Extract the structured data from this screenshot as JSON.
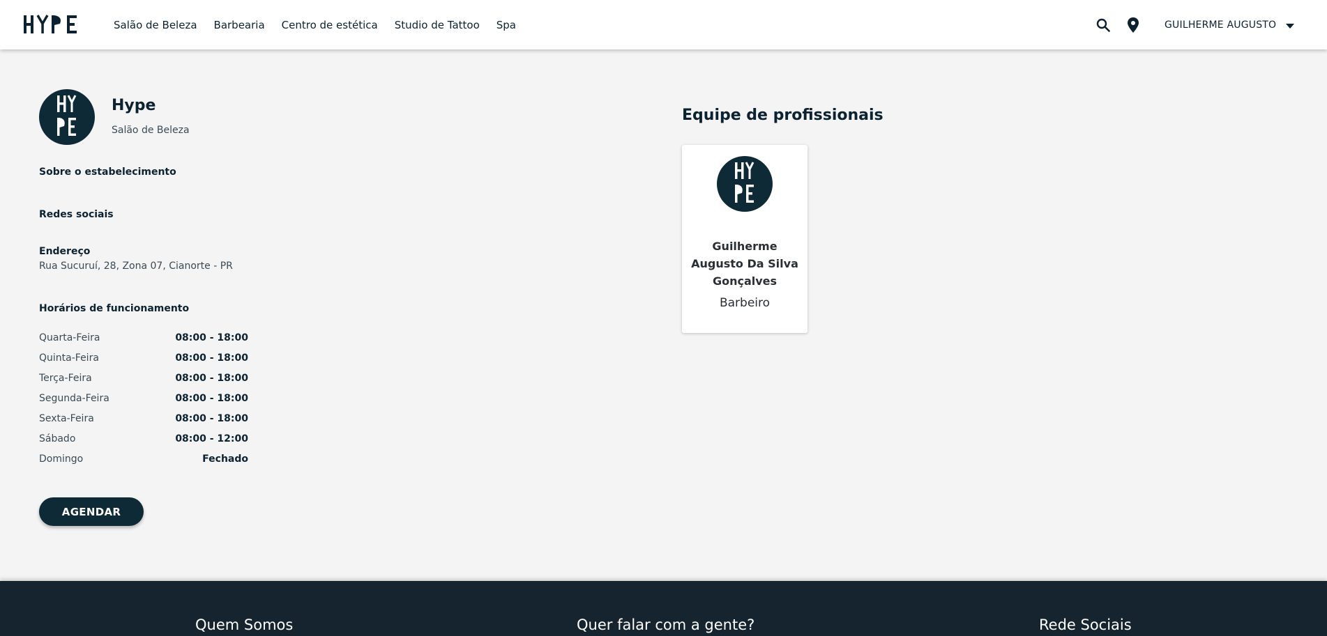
{
  "header": {
    "nav": [
      "Salão de Beleza",
      "Barbearia",
      "Centro de estética",
      "Studio de Tattoo",
      "Spa"
    ],
    "user_name": "GUILHERME AUGUSTO"
  },
  "establishment": {
    "name": "Hype",
    "category": "Salão de Beleza",
    "about_title": "Sobre o estabelecimento",
    "social_title": "Redes sociais",
    "address_title": "Endereço",
    "address": "Rua Sucuruí, 28, Zona 07, Cianorte - PR",
    "hours_title": "Horários de funcionamento",
    "hours": [
      {
        "day": "Quarta-Feira",
        "time": "08:00 - 18:00"
      },
      {
        "day": "Quinta-Feira",
        "time": "08:00 - 18:00"
      },
      {
        "day": "Terça-Feira",
        "time": "08:00 - 18:00"
      },
      {
        "day": "Segunda-Feira",
        "time": "08:00 - 18:00"
      },
      {
        "day": "Sexta-Feira",
        "time": "08:00 - 18:00"
      },
      {
        "day": "Sábado",
        "time": "08:00 - 12:00"
      },
      {
        "day": "Domingo",
        "time": "Fechado"
      }
    ],
    "schedule_button": "AGENDAR"
  },
  "team": {
    "title": "Equipe de profissionais",
    "professionals": [
      {
        "name": "Guilherme Augusto Da Silva Gonçalves",
        "role": "Barbeiro"
      }
    ]
  },
  "footer": {
    "about": "Quem Somos",
    "contact": "Quer falar com a gente?",
    "social": "Rede Sociais"
  },
  "colors": {
    "primary": "#0d2a36",
    "footer": "#15242f",
    "background": "#f4f4f4"
  }
}
